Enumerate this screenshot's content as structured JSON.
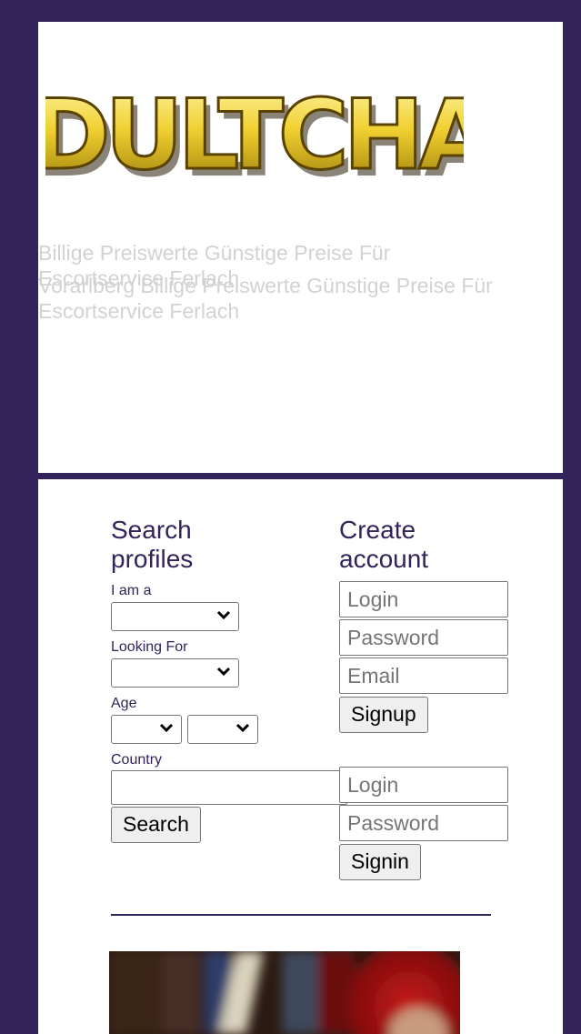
{
  "header": {
    "logo_text": "ADULTCHAT",
    "tagline_line1": "Billige Preiswerte Günstige Preise Für Escortservice Ferlach",
    "tagline_line2": "Vorarlberg Billige Preiswerte Günstige Preise Für Escortservice Ferlach"
  },
  "search": {
    "title": "Search profiles",
    "i_am_label": "I am a",
    "looking_for_label": "Looking For",
    "age_label": "Age",
    "country_label": "Country",
    "search_button": "Search"
  },
  "create_account": {
    "title": "Create account",
    "login_placeholder": "Login",
    "password_placeholder": "Password",
    "email_placeholder": "Email",
    "signup_button": "Signup"
  },
  "signin": {
    "login_placeholder": "Login",
    "password_placeholder": "Password",
    "signin_button": "Signin"
  },
  "colors": {
    "frame": "#32245a",
    "panel": "#ffffff",
    "tagline": "#d2d2d2",
    "logo_gold": "#e8c21a"
  }
}
